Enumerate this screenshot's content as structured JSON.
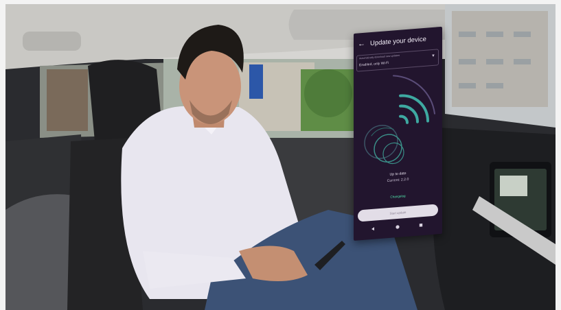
{
  "phone": {
    "title": "Update your device",
    "select_label": "Automatically download new updates",
    "select_value": "Enabled, only Wi-Fi",
    "status": "Up to date",
    "version": "Current: 2.2.0",
    "changelog": "Changelog",
    "start_button": "Start update"
  },
  "icons": {
    "back": "arrow-left-icon",
    "dropdown": "chevron-down-icon",
    "nav_back": "triangle-back-icon",
    "nav_home": "circle-home-icon",
    "nav_recent": "square-recent-icon"
  },
  "colors": {
    "phone_bg": "#22152e",
    "accent": "#4fe0a8",
    "button_bg": "#e2dde7"
  }
}
